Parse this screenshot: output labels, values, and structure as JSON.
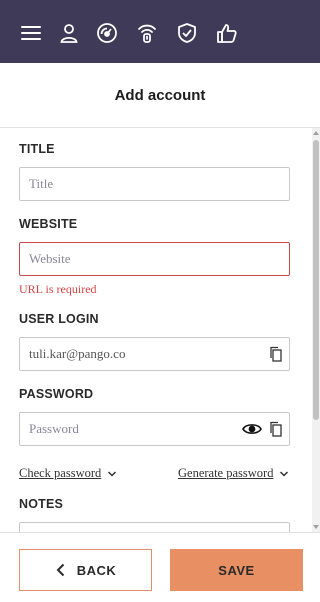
{
  "topbar": {
    "icons": [
      "menu-icon",
      "user-icon",
      "speed-gauge-icon",
      "wifi-shield-icon",
      "shield-check-icon",
      "thumbs-up-icon"
    ],
    "bg_color": "#3f3a57"
  },
  "header": {
    "title": "Add account"
  },
  "form": {
    "title_label": "TITLE",
    "title_placeholder": "Title",
    "title_value": "",
    "website_label": "WEBSITE",
    "website_placeholder": "Website",
    "website_value": "",
    "website_error": "URL is required",
    "login_label": "USER LOGIN",
    "login_value": "tuli.kar@pango.co",
    "password_label": "PASSWORD",
    "password_placeholder": "Password",
    "password_value": "",
    "check_password": "Check password",
    "generate_password": "Generate password",
    "notes_label": "NOTES"
  },
  "footer": {
    "back_label": "BACK",
    "save_label": "SAVE"
  },
  "colors": {
    "accent": "#e98f64",
    "error": "#d24545"
  }
}
